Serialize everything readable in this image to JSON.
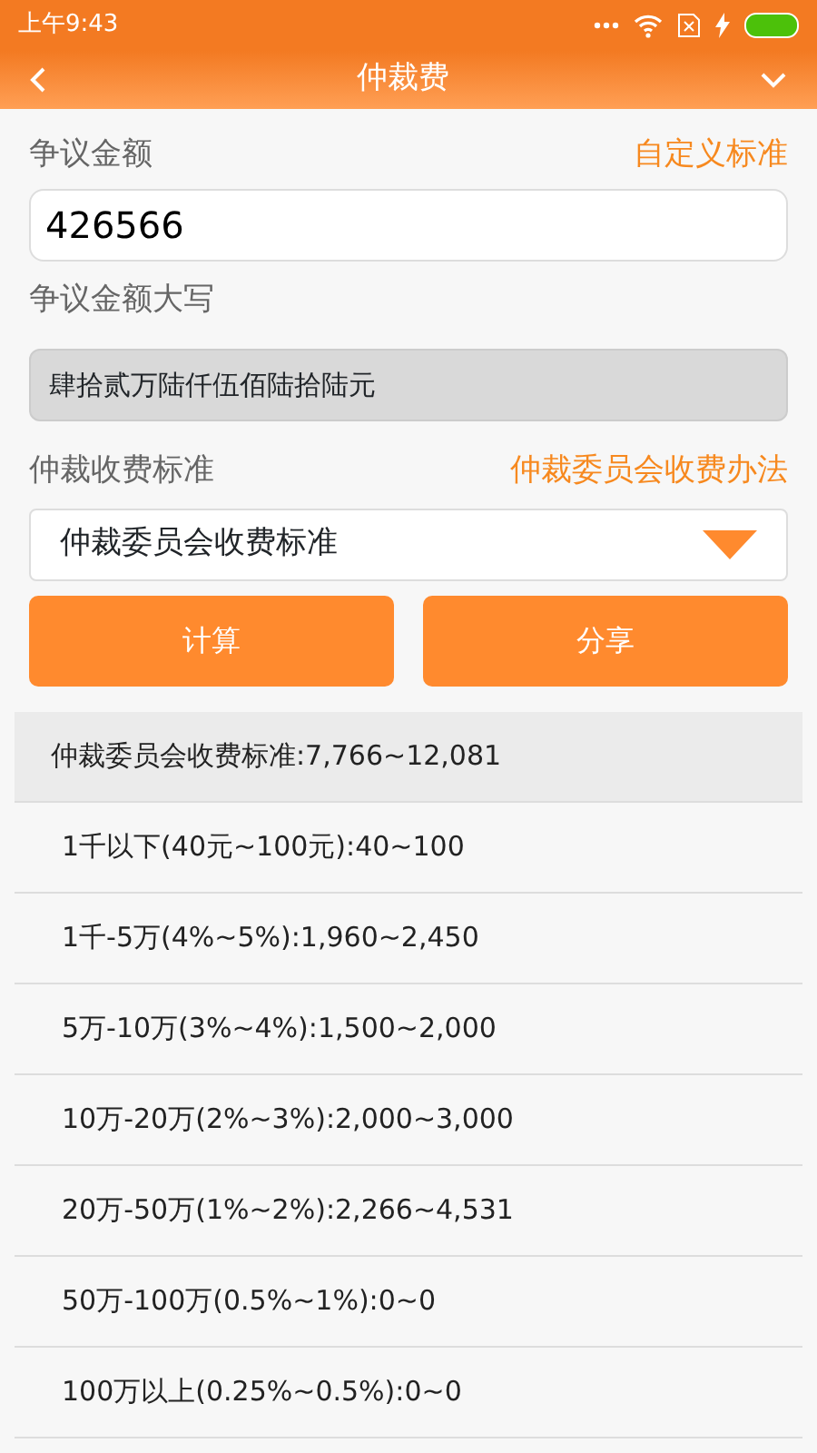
{
  "status_bar": {
    "time": "上午9:43"
  },
  "header": {
    "title": "仲裁费"
  },
  "amount": {
    "label": "争议金额",
    "link": "自定义标准",
    "value": "426566"
  },
  "uppercase": {
    "label": "争议金额大写",
    "value": "肆拾贰万陆仟伍佰陆拾陆元"
  },
  "standard": {
    "label": "仲裁收费标准",
    "link": "仲裁委员会收费办法",
    "selected_option": "仲裁委员会收费标准"
  },
  "buttons": [
    "计算",
    "分享"
  ],
  "results": [
    {
      "text": "仲裁委员会收费标准:7,766~12,081",
      "kind": "header"
    },
    {
      "text": "1千以下(40元~100元):40~100",
      "kind": "item"
    },
    {
      "text": "1千-5万(4%~5%):1,960~2,450",
      "kind": "item"
    },
    {
      "text": "5万-10万(3%~4%):1,500~2,000",
      "kind": "item"
    },
    {
      "text": "10万-20万(2%~3%):2,000~3,000",
      "kind": "item"
    },
    {
      "text": "20万-50万(1%~2%):2,266~4,531",
      "kind": "item"
    },
    {
      "text": "50万-100万(0.5%~1%):0~0",
      "kind": "item"
    },
    {
      "text": "100万以上(0.25%~0.5%):0~0",
      "kind": "item"
    }
  ]
}
